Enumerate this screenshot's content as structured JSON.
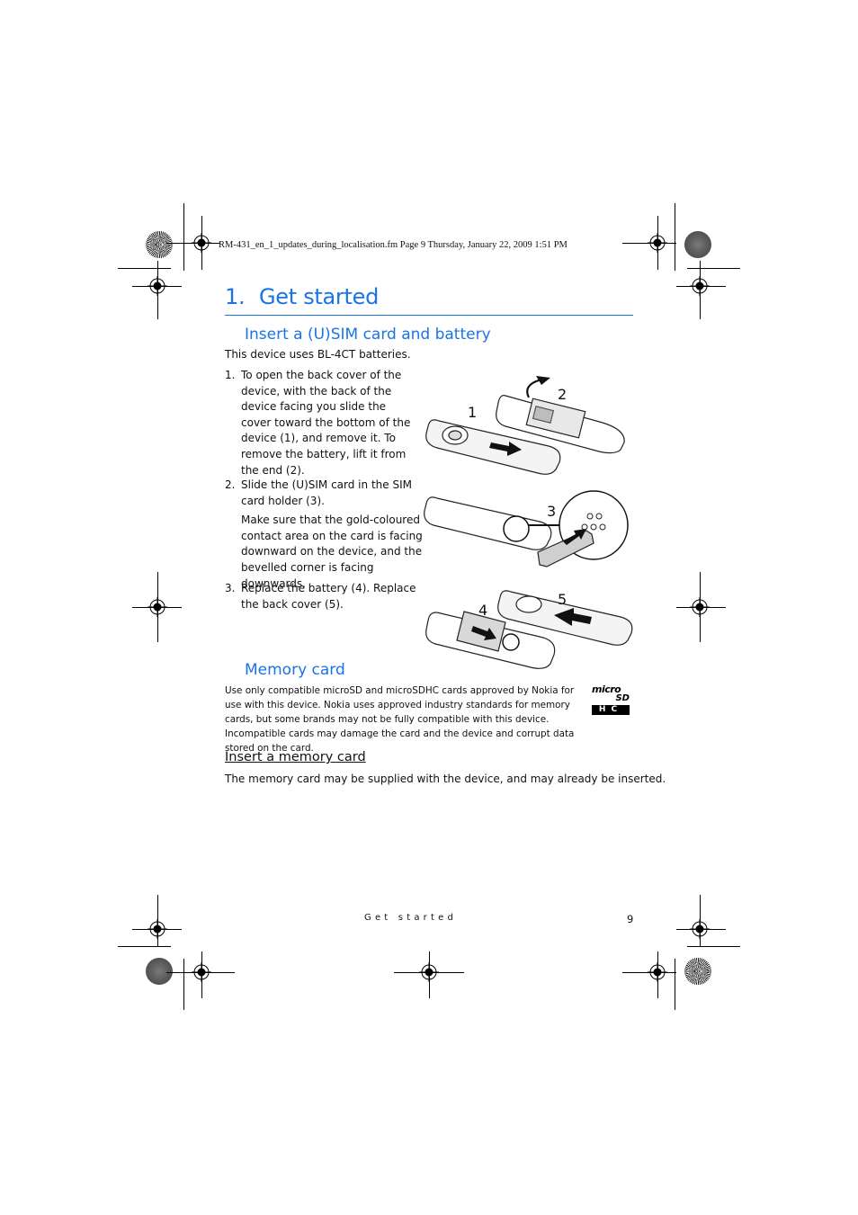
{
  "print_header": {
    "text": "RM-431_en_1_updates_during_localisation.fm  Page 9  Thursday, January 22, 2009  1:51 PM"
  },
  "chapter": {
    "number": "1.",
    "title": "Get started"
  },
  "section_sim": {
    "heading": "Insert a (U)SIM card and battery",
    "intro": "This device uses BL-4CT batteries.",
    "steps": [
      {
        "number": "1.",
        "text": "To open the back cover of the device, with the back of the device facing you slide the cover toward the bottom of the device (1), and remove it. To remove the battery, lift it from the end (2)."
      },
      {
        "number": "2.",
        "text": "Slide the (U)SIM card in the SIM card holder (3).",
        "note": "Make sure that the gold-coloured contact area on the card is facing downward on the device, and the bevelled corner is facing downwards."
      },
      {
        "number": "3.",
        "text": "Replace the battery (4). Replace the back cover (5)."
      }
    ],
    "illustration_labels": [
      "1",
      "2",
      "3",
      "4",
      "5"
    ]
  },
  "section_memory": {
    "heading": "Memory card",
    "text": "Use only compatible microSD and microSDHC cards approved by Nokia for use with this device. Nokia uses approved industry standards for memory cards, but some brands may not be fully compatible with this device. Incompatible cards may damage the card and the device and corrupt data stored on the card.",
    "logo": {
      "line1": "micro",
      "line2": "SD",
      "line3": "HC"
    },
    "subsection": {
      "heading": "Insert a memory card",
      "text": "The memory card may be supplied with the device, and may already be inserted."
    }
  },
  "footer": {
    "section_label": "Get started",
    "page_number": "9"
  },
  "colors": {
    "heading_blue": "#1a73e8",
    "text": "#111111"
  }
}
